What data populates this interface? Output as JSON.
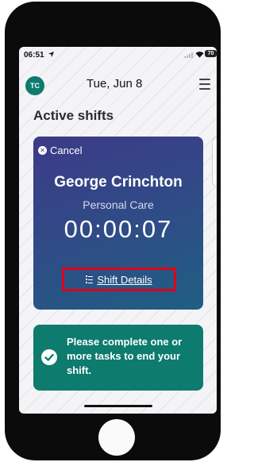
{
  "status_bar": {
    "time": "06:51",
    "battery": "70",
    "icons": [
      "location-arrow-icon",
      "signal-icon",
      "wifi-icon",
      "battery-icon"
    ]
  },
  "header": {
    "avatar_initials": "TC",
    "date": "Tue, Jun 8",
    "menu_icon": "hamburger-menu-icon"
  },
  "section_title": "Active shifts",
  "shift_card": {
    "cancel_label": "Cancel",
    "client_name": "George Crinchton",
    "service": "Personal Care",
    "timer": "00:00:07",
    "details_label": "Shift Details"
  },
  "notice": {
    "text": "Please complete one or more tasks to end your shift."
  },
  "colors": {
    "card_gradient_start": "#3d3a88",
    "card_gradient_end": "#1f5f82",
    "brand_teal": "#0d7b6e",
    "highlight_red": "#e0001b"
  }
}
